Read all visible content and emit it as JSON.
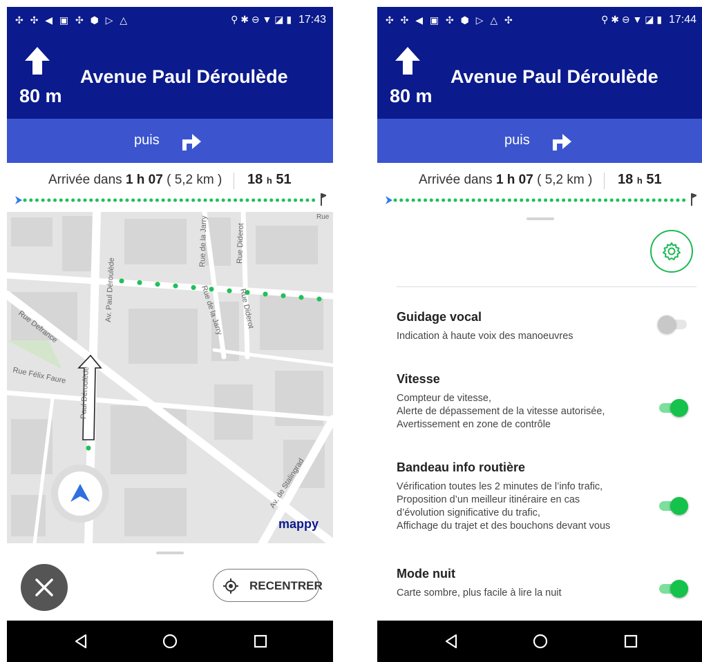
{
  "left_screen": {
    "status_bar": {
      "icons": "✣ ✣ ◀ ▣ ✣ ⬢ ▷ △",
      "right_icons": "⚲ ✱ ⊖ ▼ ◪ ▮",
      "time": "17:43"
    },
    "instruction": {
      "distance": "80 m",
      "street": "Avenue Paul Déroulède",
      "direction_icon": "arrow-up-icon"
    },
    "next_maneuver": {
      "label": "puis",
      "icon": "turn-right-icon"
    },
    "eta": {
      "prefix": "Arrivée dans",
      "duration": "1 h 07",
      "distance": "( 5,2 km )",
      "arrival_hour": "18",
      "arrival_h": "h",
      "arrival_min": "51"
    },
    "map": {
      "streets": [
        "Av. Paul Déroulède",
        "Rue de la Jarry",
        "Rue Diderot",
        "Rue de la Jarry",
        "Rue Diderot",
        "Rue Defrance",
        "Rue Félix Faure",
        "Av. de Stalingrad",
        "Rue",
        "Rue"
      ],
      "partial_street_fragments": [
        "Rue",
        "Paul Déroulède",
        "ur"
      ],
      "logo": "mappy",
      "colors": {
        "route": "#1fc05a",
        "map_background": "#e4e4e4",
        "position_marker": "#2f6fe0"
      }
    },
    "controls": {
      "close_icon": "close-icon",
      "recenter_label": "RECENTRER",
      "recenter_icon": "crosshair-icon"
    },
    "android_nav": [
      "back-icon",
      "home-icon",
      "recents-icon"
    ]
  },
  "right_screen": {
    "status_bar": {
      "icons": "✣ ✣ ◀ ▣ ✣ ⬢ ▷ △ ✣",
      "right_icons": "⚲ ✱ ⊖ ▼ ◪ ▮",
      "time": "17:44"
    },
    "instruction": {
      "distance": "80 m",
      "street": "Avenue Paul Déroulède",
      "direction_icon": "arrow-up-icon"
    },
    "next_maneuver": {
      "label": "puis",
      "icon": "turn-right-icon"
    },
    "eta": {
      "prefix": "Arrivée dans",
      "duration": "1 h 07",
      "distance": "( 5,2 km )",
      "arrival_hour": "18",
      "arrival_h": "h",
      "arrival_min": "51"
    },
    "settings_icon": "gear-icon",
    "settings": [
      {
        "title": "Guidage vocal",
        "desc": [
          "Indication à haute voix des manoeuvres"
        ],
        "enabled": false
      },
      {
        "title": "Vitesse",
        "desc": [
          "Compteur de vitesse,",
          "Alerte de dépassement de la vitesse autorisée,",
          "Avertissement en zone de contrôle"
        ],
        "enabled": true
      },
      {
        "title": "Bandeau info routière",
        "desc": [
          "Vérification toutes les 2 minutes de l’info trafic,",
          "Proposition d’un meilleur itinéraire en cas",
          "d’évolution significative du trafic,",
          "Affichage du trajet et des bouchons devant vous"
        ],
        "enabled": true
      },
      {
        "title": "Mode nuit",
        "desc": [
          "Carte sombre, plus facile à lire la nuit"
        ],
        "enabled": true
      }
    ],
    "android_nav": [
      "back-icon",
      "home-icon",
      "recents-icon"
    ]
  },
  "colors": {
    "header_dark": "#0b1a8c",
    "header_light": "#3c55cf",
    "accent_green": "#1db954",
    "toggle_on": "#15c24b"
  }
}
